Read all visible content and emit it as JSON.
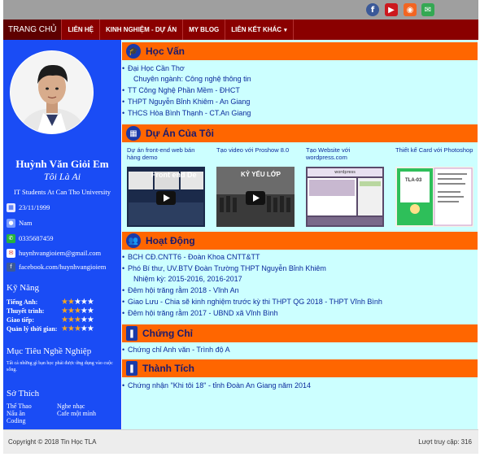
{
  "social": {
    "icons": [
      "facebook-icon",
      "youtube-icon",
      "rss-icon",
      "gmail-icon"
    ]
  },
  "nav": {
    "home": "TRANG CHỦ",
    "items": [
      "LIÊN HỆ",
      "KINH NGHIỆM - DỰ ÁN",
      "MY BLOG",
      "LIÊN KẾT KHÁC"
    ],
    "dropdown_caret": "▾"
  },
  "profile": {
    "name": "Huỳnh Văn Giỏi Em",
    "tagline": "Tôi Là Ai",
    "bio": "IT Students At Can Tho University",
    "birthday": "23/11/1999",
    "gender": "Nam",
    "phone": "0335687459",
    "email": "huynhvangioiem@gmail.com",
    "facebook": "facebook.com/huynhvangioiem"
  },
  "skills": {
    "heading": "Kỹ Năng",
    "items": [
      {
        "label": "Tiếng Anh:",
        "rating": 2,
        "max": 5
      },
      {
        "label": "Thuyết trình:",
        "rating": 3,
        "max": 5
      },
      {
        "label": "Giao tiếp:",
        "rating": 3,
        "max": 5
      },
      {
        "label": "Quản lý thời gian:",
        "rating": 3,
        "max": 5
      }
    ]
  },
  "goal": {
    "heading": "Mục Tiêu Nghề Nghiệp",
    "text": "Tất cả những gì bạn học phải được ứng dụng vào cuộc sống."
  },
  "hobbies": {
    "heading": "Sở Thích",
    "col1": [
      "Thể Thao",
      "Nấu ăn",
      "Coding"
    ],
    "col2": [
      "Nghe nhạc",
      "Cafe một mình"
    ]
  },
  "education": {
    "title": "Học Vấn",
    "items": [
      "Đại Học Cần Thơ",
      "TT Công Nghệ Phần Mềm - ĐHCT",
      "THPT Nguyễn Bỉnh Khiêm - An Giang",
      "THCS Hòa Bình Thạnh - CT.An Giang"
    ],
    "major": "Chuyên ngành: Công nghệ thông tin"
  },
  "projects": {
    "title": "Dự Án Của Tôi",
    "items": [
      {
        "title": "Dự án front-end web bán hàng demo",
        "thumb_label": "Front end De"
      },
      {
        "title": "Tạo video với Proshow 8.0",
        "thumb_label": "KỶ YẾU LỚP"
      },
      {
        "title": "Tạo Website với wordpress.com",
        "thumb_label": ""
      },
      {
        "title": "Thiết kế Card với Photoshop",
        "thumb_label": "TLA-03"
      }
    ]
  },
  "activities": {
    "title": "Hoạt Động",
    "items": [
      "BCH CĐ.CNTT6 - Đoàn Khoa CNTT&TT",
      "Phó Bí thư, UV.BTV Đoàn Trường THPT Nguyễn Bỉnh Khiêm",
      "Đêm hội trăng rằm 2018 - Vĩnh An",
      "Giao Lưu - Chia sẽ kinh nghiệm trước kỳ thi THPT QG 2018 - THPT Vĩnh Bình",
      "Đêm hội trăng rằm 2017 - UBND xã Vĩnh Bình"
    ],
    "term": "Nhiệm kỳ: 2015-2016, 2016-2017"
  },
  "certificates": {
    "title": "Chứng Chỉ",
    "items": [
      "Chứng chỉ Anh văn - Trình độ A"
    ]
  },
  "achievements": {
    "title": "Thành Tích",
    "items": [
      "Chứng nhận \"Khi tôi 18\" - tỉnh Đoàn An Giang năm 2014"
    ]
  },
  "footer": {
    "copyright": "Copyright © 2018 Tin Học TLA",
    "visits_label": "Lượt truy cập: 316"
  },
  "colors": {
    "nav_bg": "#8a0000",
    "sidebar_bg": "#1a4cf5",
    "main_bg": "#ccffff",
    "section_head": "#ff6600",
    "link_text": "#0b2a9c",
    "star": "#f6a623"
  }
}
